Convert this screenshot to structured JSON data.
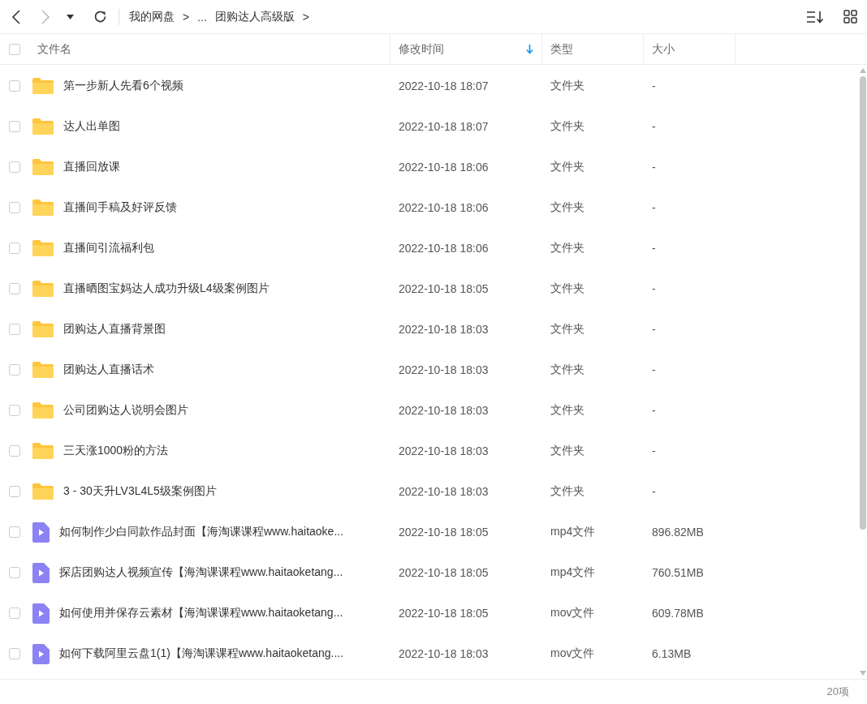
{
  "toolbar": {
    "breadcrumbs": [
      "我的网盘",
      ">",
      "...",
      "团购达人高级版",
      ">"
    ]
  },
  "table": {
    "select_all_checked": false,
    "columns": [
      {
        "label": "文件名",
        "sorted": false
      },
      {
        "label": "修改时间",
        "sorted": true
      },
      {
        "label": "类型",
        "sorted": false
      },
      {
        "label": "大小",
        "sorted": false
      }
    ],
    "rows": [
      {
        "kind": "folder",
        "checked": false,
        "name": "第一步新人先看6个视频",
        "modified": "2022-10-18 18:07",
        "type": "文件夹",
        "size": "-"
      },
      {
        "kind": "folder",
        "checked": false,
        "name": "达人出单图",
        "modified": "2022-10-18 18:07",
        "type": "文件夹",
        "size": "-"
      },
      {
        "kind": "folder",
        "checked": false,
        "name": "直播回放课",
        "modified": "2022-10-18 18:06",
        "type": "文件夹",
        "size": "-"
      },
      {
        "kind": "folder",
        "checked": false,
        "name": "直播间手稿及好评反馈",
        "modified": "2022-10-18 18:06",
        "type": "文件夹",
        "size": "-"
      },
      {
        "kind": "folder",
        "checked": false,
        "name": "直播间引流福利包",
        "modified": "2022-10-18 18:06",
        "type": "文件夹",
        "size": "-"
      },
      {
        "kind": "folder",
        "checked": false,
        "name": "直播晒图宝妈达人成功升级L4级案例图片",
        "modified": "2022-10-18 18:05",
        "type": "文件夹",
        "size": "-"
      },
      {
        "kind": "folder",
        "checked": false,
        "name": "团购达人直播背景图",
        "modified": "2022-10-18 18:03",
        "type": "文件夹",
        "size": "-"
      },
      {
        "kind": "folder",
        "checked": false,
        "name": "团购达人直播话术",
        "modified": "2022-10-18 18:03",
        "type": "文件夹",
        "size": "-"
      },
      {
        "kind": "folder",
        "checked": false,
        "name": "公司团购达人说明会图片",
        "modified": "2022-10-18 18:03",
        "type": "文件夹",
        "size": "-"
      },
      {
        "kind": "folder",
        "checked": false,
        "name": "三天涨1000粉的方法",
        "modified": "2022-10-18 18:03",
        "type": "文件夹",
        "size": "-"
      },
      {
        "kind": "folder",
        "checked": false,
        "name": "3 - 30天升LV3L4L5级案例图片",
        "modified": "2022-10-18 18:03",
        "type": "文件夹",
        "size": "-"
      },
      {
        "kind": "video",
        "checked": false,
        "name": "如何制作少白同款作品封面【海淘课课程www.haitaoke...",
        "modified": "2022-10-18 18:05",
        "type": "mp4文件",
        "size": "896.82MB"
      },
      {
        "kind": "video",
        "checked": false,
        "name": "探店团购达人视频宣传【海淘课课程www.haitaoketang...",
        "modified": "2022-10-18 18:05",
        "type": "mp4文件",
        "size": "760.51MB"
      },
      {
        "kind": "video",
        "checked": false,
        "name": "如何使用并保存云素材【海淘课课程www.haitaoketang...",
        "modified": "2022-10-18 18:05",
        "type": "mov文件",
        "size": "609.78MB"
      },
      {
        "kind": "video",
        "checked": false,
        "name": "如何下载阿里云盘1(1)【海淘课课程www.haitaoketang....",
        "modified": "2022-10-18 18:03",
        "type": "mov文件",
        "size": "6.13MB"
      }
    ]
  },
  "status_bar": {
    "count": "20项"
  }
}
